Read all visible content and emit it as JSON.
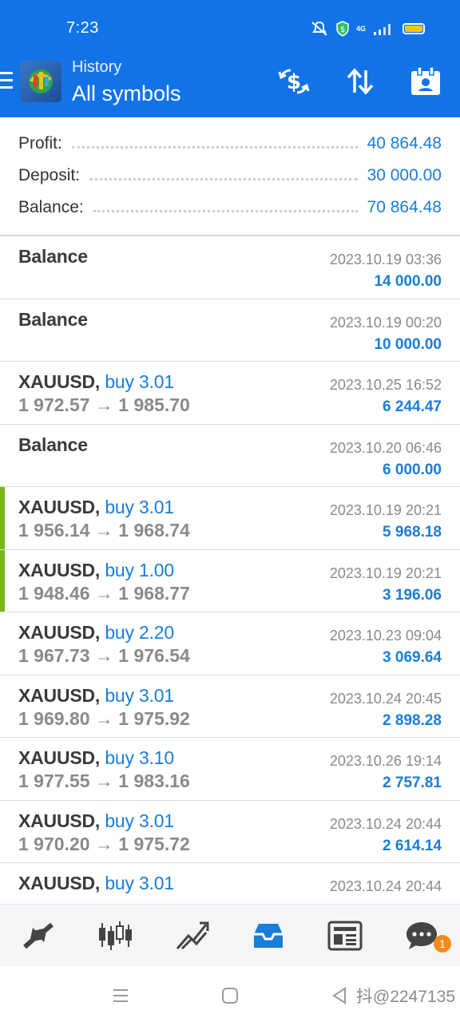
{
  "status": {
    "time": "7:23",
    "network": "4G",
    "battery_color": "#f5c518"
  },
  "appbar": {
    "subtitle": "History",
    "title": "All symbols",
    "icons": [
      "menu-icon",
      "metatrader-logo",
      "currency-exchange-icon",
      "sort-icon",
      "calendar-icon"
    ]
  },
  "summary": {
    "profit_label": "Profit:",
    "profit_value": "40 864.48",
    "deposit_label": "Deposit:",
    "deposit_value": "30 000.00",
    "balance_label": "Balance:",
    "balance_value": "70 864.48"
  },
  "rows": [
    {
      "title": "Balance",
      "action": "",
      "prices": "",
      "time": "2023.10.19 03:36",
      "amount": "14 000.00",
      "accent": false
    },
    {
      "title": "Balance",
      "action": "",
      "prices": "",
      "time": "2023.10.19 00:20",
      "amount": "10 000.00",
      "accent": false
    },
    {
      "title": "XAUUSD,",
      "action": " buy 3.01",
      "prices": "1 972.57 → 1 985.70",
      "time": "2023.10.25 16:52",
      "amount": "6 244.47",
      "accent": false
    },
    {
      "title": "Balance",
      "action": "",
      "prices": "",
      "time": "2023.10.20 06:46",
      "amount": "6 000.00",
      "accent": false
    },
    {
      "title": "XAUUSD,",
      "action": " buy 3.01",
      "prices": "1 956.14 → 1 968.74",
      "time": "2023.10.19 20:21",
      "amount": "5 968.18",
      "accent": true
    },
    {
      "title": "XAUUSD,",
      "action": " buy 1.00",
      "prices": "1 948.46 → 1 968.77",
      "time": "2023.10.19 20:21",
      "amount": "3 196.06",
      "accent": true
    },
    {
      "title": "XAUUSD,",
      "action": " buy 2.20",
      "prices": "1 967.73 → 1 976.54",
      "time": "2023.10.23 09:04",
      "amount": "3 069.64",
      "accent": false
    },
    {
      "title": "XAUUSD,",
      "action": " buy 3.01",
      "prices": "1 969.80 → 1 975.92",
      "time": "2023.10.24 20:45",
      "amount": "2 898.28",
      "accent": false
    },
    {
      "title": "XAUUSD,",
      "action": " buy 3.10",
      "prices": "1 977.55 → 1 983.16",
      "time": "2023.10.26 19:14",
      "amount": "2 757.81",
      "accent": false
    },
    {
      "title": "XAUUSD,",
      "action": " buy 3.01",
      "prices": "1 970.20 → 1 975.72",
      "time": "2023.10.24 20:44",
      "amount": "2 614.14",
      "accent": false
    },
    {
      "title": "XAUUSD,",
      "action": " buy 3.01",
      "prices": "",
      "time": "2023.10.24 20:44",
      "amount": "",
      "accent": false
    }
  ],
  "bottom_nav": {
    "items": [
      "quotes-icon",
      "chart-icon",
      "trade-icon",
      "history-icon",
      "news-icon",
      "messages-icon"
    ],
    "active": "history-icon",
    "messages_badge": "1"
  },
  "watermark": "抖@2247135",
  "colors": {
    "brand": "#1273e8",
    "accent_blue": "#1a7dd8",
    "profit_bar": "#79b51c"
  }
}
